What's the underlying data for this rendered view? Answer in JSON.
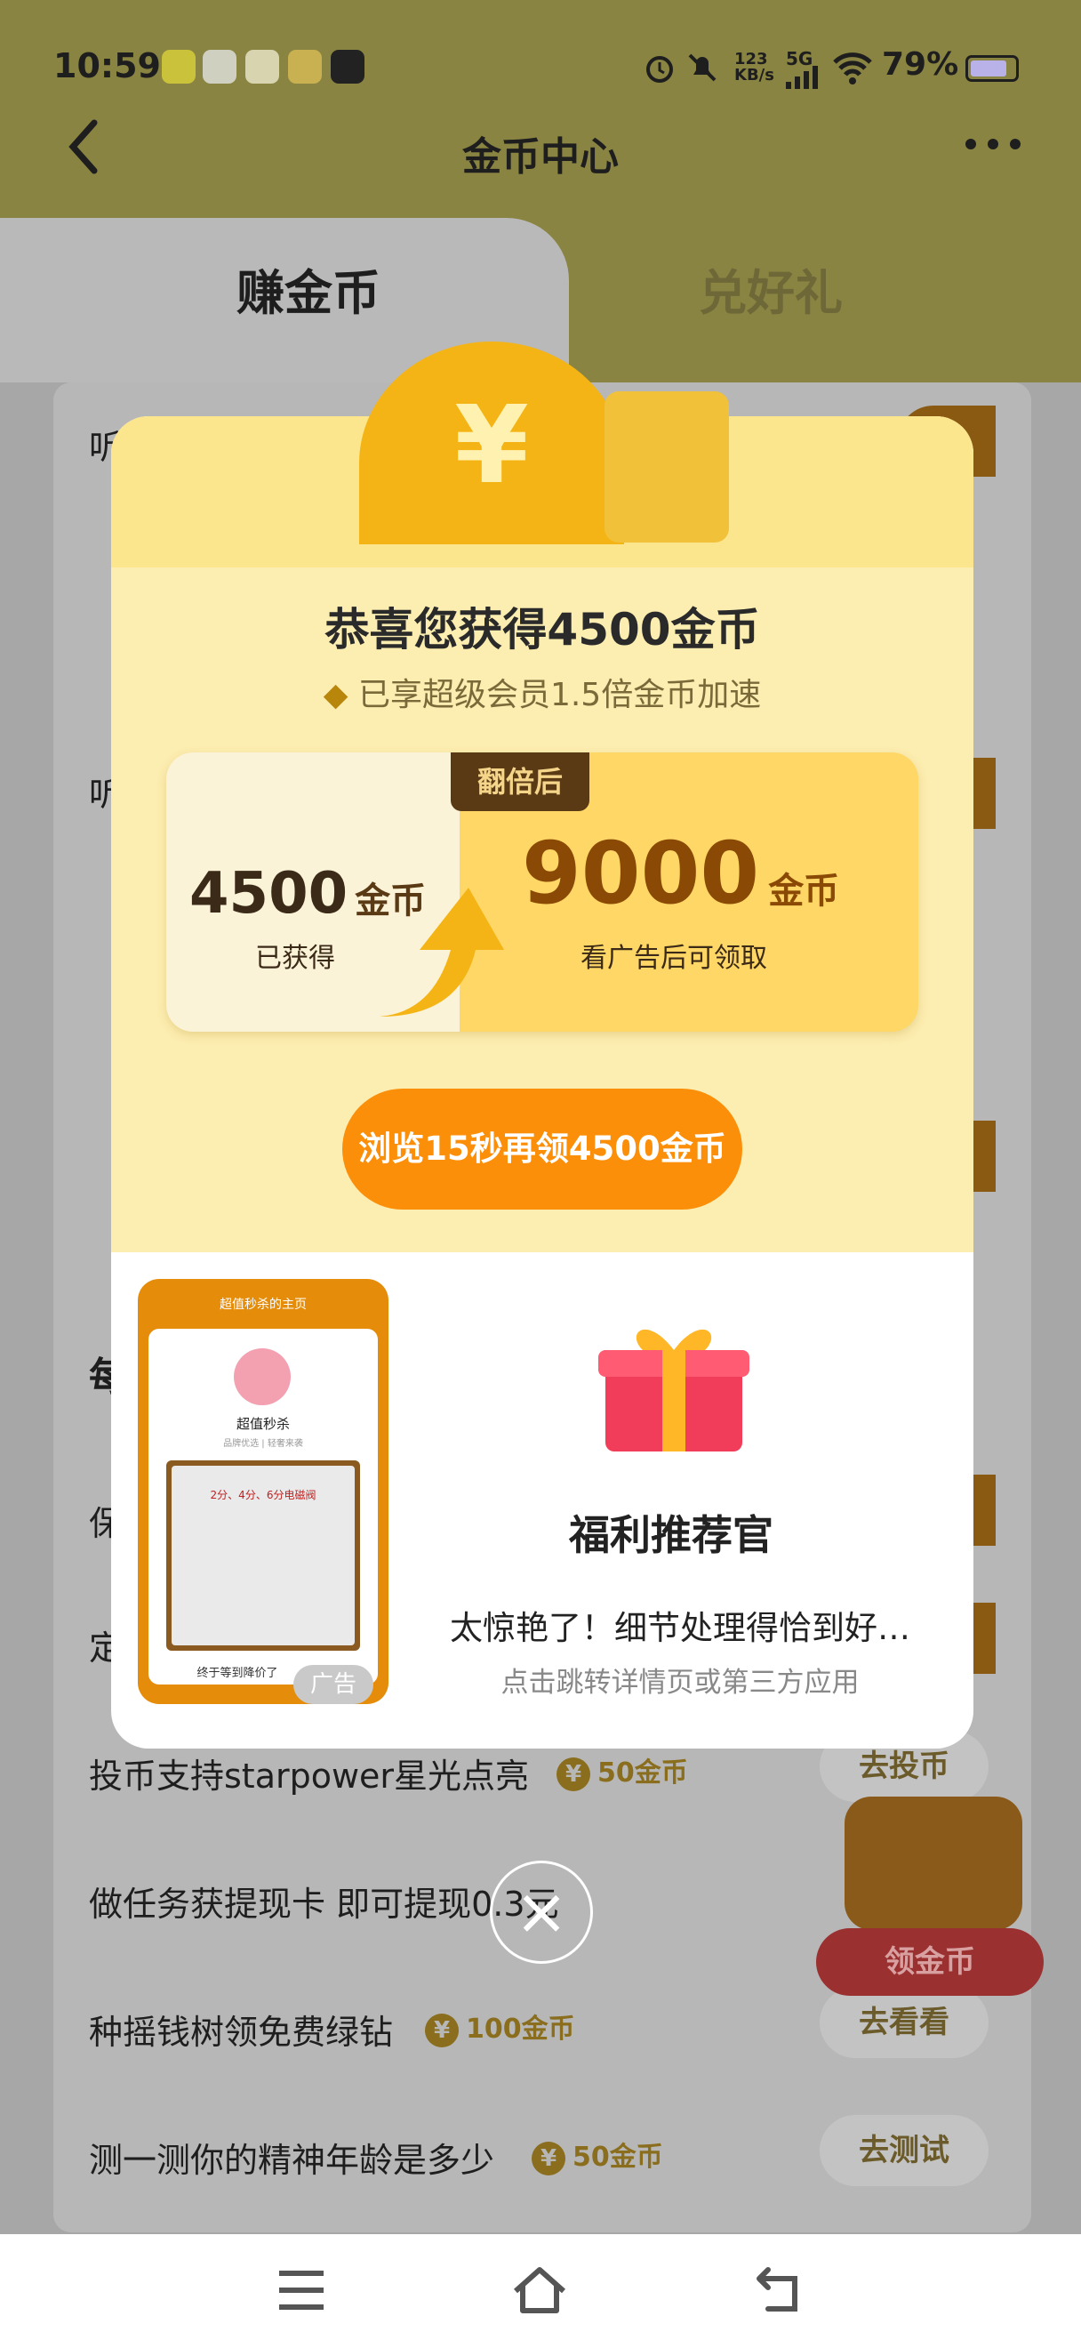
{
  "status_bar": {
    "time": "10:59",
    "speed": "123\nKB/s",
    "network": "5G",
    "battery": "79%"
  },
  "nav": {
    "title": "金币中心"
  },
  "tabs": [
    {
      "label": "赚金币"
    },
    {
      "label": "兑好礼"
    }
  ],
  "list": {
    "rows": [
      {
        "text": "投币支持starpower星光点亮",
        "coins": "50金币",
        "button": "去投币"
      },
      {
        "text": "做任务获提现卡 即可提现0.3元",
        "coins": "",
        "button": ""
      },
      {
        "text": "种摇钱树领免费绿钻",
        "coins": "100金币",
        "button": "去看看"
      },
      {
        "text": "测一测你的精神年龄是多少",
        "coins": "50金币",
        "button": "去测试"
      }
    ],
    "partial_labels": [
      "听",
      "听",
      "每",
      "保",
      "定"
    ]
  },
  "popup": {
    "title": "恭喜您获得4500金币",
    "vip_note": "已享超级会员1.5倍金币加速",
    "doubled_tag": "翻倍后",
    "earned": {
      "amount": "4500",
      "unit": "金币",
      "label": "已获得"
    },
    "doubled": {
      "amount": "9000",
      "unit": "金币",
      "label": "看广告后可领取"
    },
    "cta": "浏览15秒再领4500金币",
    "ad": {
      "card_header": "超值秒杀的主页",
      "card_name": "超值秒杀",
      "card_tagline": "品牌优选 | 轻奢来袭",
      "card_product": "2分、4分、6分电磁阀",
      "card_footer": "终于等到降价了",
      "tag": "广告",
      "title": "福利推荐官",
      "desc": "太惊艳了！细节处理得恰到好…",
      "sub": "点击跳转详情页或第三方应用"
    }
  },
  "float": {
    "get_coins": "领金币"
  },
  "colors": {
    "accent": "#fb8f0a",
    "popup_bg": "#fcedb0",
    "dim_header": "#8a8442"
  }
}
